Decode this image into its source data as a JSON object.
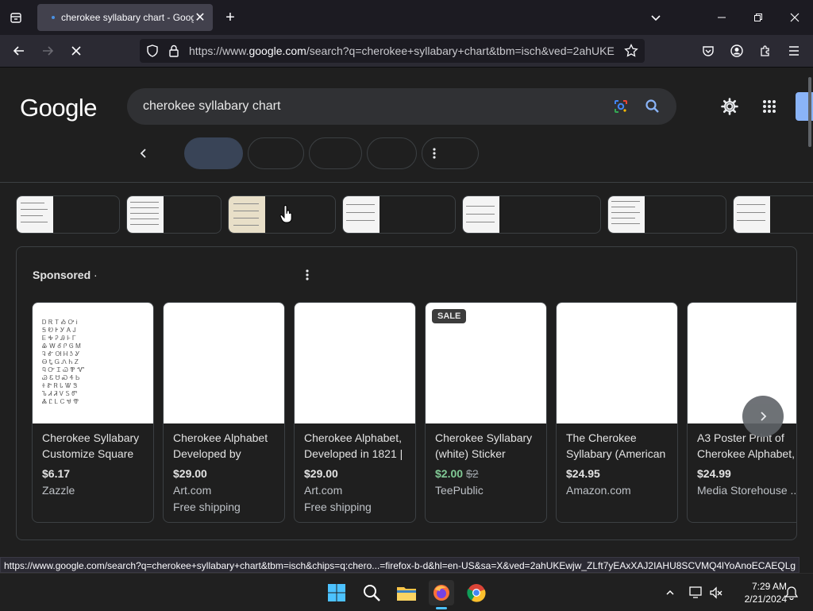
{
  "browser": {
    "tab_title": "cherokee syllabary chart - Goog",
    "url_prefix": "https://www.",
    "url_domain": "google.com",
    "url_rest": "/search?q=cherokee+syllabary+chart&tbm=isch&ved=2ahUKE",
    "status_url": "https://www.google.com/search?q=cherokee+syllabary+chart&tbm=isch&chips=q:chero...=firefox-b-d&hl=en-US&sa=X&ved=2ahUKEwjw_ZLft7yEAxXAJ2IAHU8SCVMQ4lYoAnoECAEQLg"
  },
  "google": {
    "logo": "Google",
    "query": "cherokee syllabary chart"
  },
  "sponsored": {
    "label": "Sponsored",
    "label_suffix": "·",
    "products": [
      {
        "title": "Cherokee Syllabary Customize Square",
        "price": "$6.17",
        "store": "Zazzle",
        "shipping": ""
      },
      {
        "title": "Cherokee Alphabet Developed by",
        "price": "$29.00",
        "store": "Art.com",
        "shipping": "Free shipping"
      },
      {
        "title": "Cherokee Alphabet, Developed in 1821 |",
        "price": "$29.00",
        "store": "Art.com",
        "shipping": "Free shipping"
      },
      {
        "title": "Cherokee Syllabary (white) Sticker",
        "price": "$2.00",
        "old_price": "$2",
        "store": "TeePublic",
        "shipping": "",
        "badge": "SALE"
      },
      {
        "title": "The Cherokee Syllabary (American",
        "price": "$24.95",
        "store": "Amazon.com",
        "shipping": ""
      },
      {
        "title": "A3 Poster Print of Cherokee Alphabet,",
        "price": "$24.99",
        "store": "Media Storehouse ...",
        "shipping": ""
      }
    ]
  },
  "taskbar": {
    "time": "7:29 AM",
    "date": "2/21/2024"
  },
  "colors": {
    "accent": "#8ab4f8",
    "sale_price": "#81c995",
    "firefox_chrome": "#2b2a33"
  }
}
